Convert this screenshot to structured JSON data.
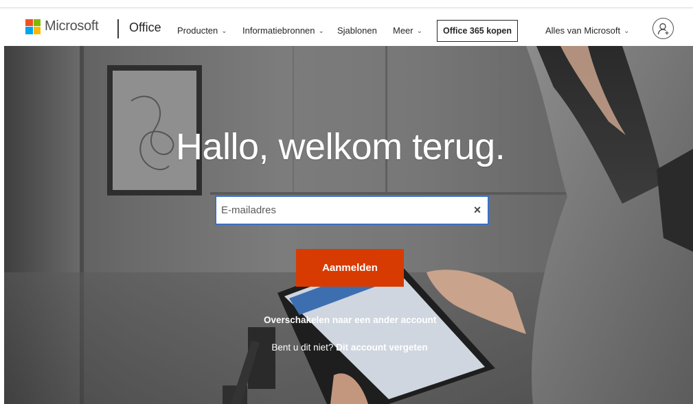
{
  "header": {
    "brand": "Microsoft",
    "product": "Office",
    "nav": [
      {
        "label": "Producten",
        "has_dropdown": true
      },
      {
        "label": "Informatiebronnen",
        "has_dropdown": true
      },
      {
        "label": "Sjablonen",
        "has_dropdown": false
      },
      {
        "label": "Meer",
        "has_dropdown": true
      }
    ],
    "buy_button": "Office 365 kopen",
    "all_microsoft": "Alles van Microsoft",
    "account_icon": "person-icon"
  },
  "hero": {
    "title": "Hallo, welkom terug.",
    "email_placeholder": "E-mailadres",
    "email_value": "",
    "clear_glyph": "×",
    "signin_label": "Aanmelden",
    "switch_account": "Overschakelen naar een ander account",
    "not_you_prefix": "Bent u dit niet?",
    "forget_account": "Dit account vergeten"
  },
  "colors": {
    "logo_red": "#f25022",
    "logo_green": "#7fba00",
    "logo_blue": "#00a4ef",
    "logo_yellow": "#ffb900",
    "signin_button": "#d83b01",
    "input_focus_border": "#3b6fc4"
  }
}
